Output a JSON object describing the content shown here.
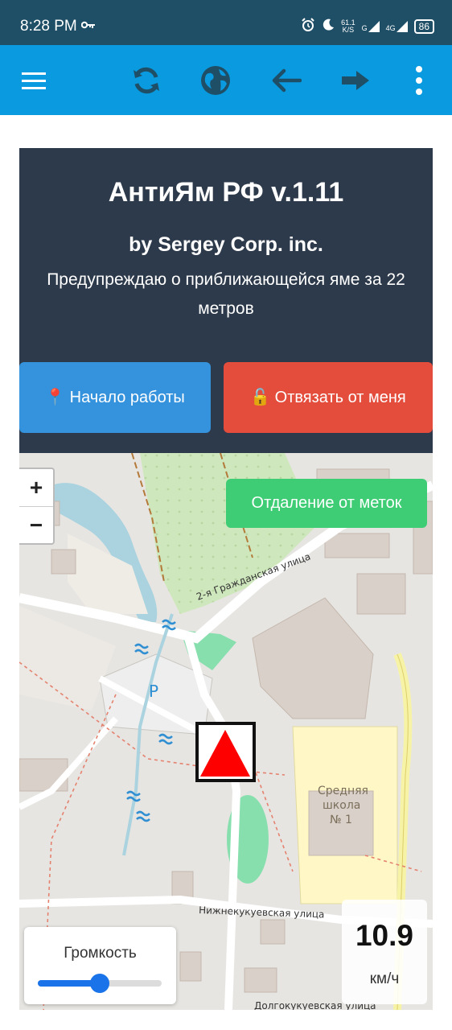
{
  "status_bar": {
    "time": "8:28 PM",
    "network_speed_value": "61.1",
    "network_speed_unit": "K/S",
    "signal_1": "G",
    "signal_2": "4G",
    "battery": "86",
    "icons": [
      "key-icon",
      "alarm-icon",
      "moon-icon",
      "signal-icon",
      "battery-icon"
    ]
  },
  "toolbar": {
    "icons": [
      "menu-icon",
      "refresh-icon",
      "globe-icon",
      "back-arrow-icon",
      "forward-arrow-icon",
      "more-vert-icon"
    ],
    "color": "#0a9ae0"
  },
  "header_card": {
    "title": "АнтиЯм РФ v.1.11",
    "author": "by Sergey Corp. inc.",
    "description": "Предупреждаю о приближающейся яме за 22 метров",
    "start_button": "📍 Начало работы",
    "unbind_button": "🔓 Отвязать от меня"
  },
  "map": {
    "zoom_in": "+",
    "zoom_out": "−",
    "distance_button": "Отдаление от меток",
    "labels": {
      "street_1": "2-я Гражданская улица",
      "street_2": "Нижнекукуевская улица",
      "street_3": "Долгокукуевская улица",
      "parking": "P",
      "school_line1": "Средняя",
      "school_line2": "школа",
      "school_line3": "№ 1"
    },
    "marker": "warning-triangle-marker"
  },
  "volume": {
    "label": "Громкость",
    "level": 0.5
  },
  "speed": {
    "value": "10.9",
    "unit": "км/ч"
  },
  "colors": {
    "status_bar": "#1f4f66",
    "card_bg": "#2d3a4b",
    "start_btn": "#3592dc",
    "unbind_btn": "#e44c3c",
    "distance_btn": "#3ecd75",
    "slider": "#1a73e8"
  }
}
